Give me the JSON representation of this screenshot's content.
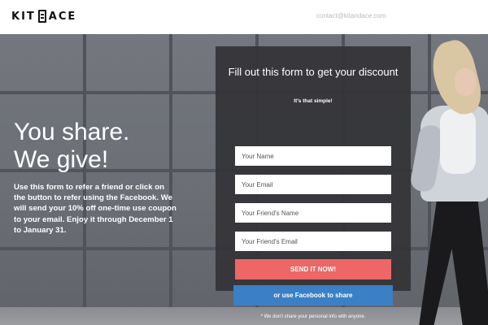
{
  "header": {
    "logo_text_left": "KIT",
    "logo_text_right": "ACE",
    "contact_email": "contact@kitandace.com"
  },
  "hero": {
    "headline_line1": "You share.",
    "headline_line2": "We give!",
    "description": "Use this form to refer a friend or click on the button to refer using the Facebook. We will send your 10% off one-time use coupon to your email. Enjoy it through December 1 to January 31."
  },
  "form": {
    "title": "Fill out this form to get your discount",
    "subtitle": "It's that simple!",
    "fields": {
      "your_name_placeholder": "Your Name",
      "your_email_placeholder": "Your Email",
      "friend_name_placeholder": "Your Friend's Name",
      "friend_email_placeholder": "Your Friend's Email"
    },
    "send_label": "SEND IT NOW!",
    "facebook_label": "or use Facebook to share",
    "privacy_note": "* We don't share your personal info with anyone."
  },
  "colors": {
    "send_button": "#ee6666",
    "facebook_button": "#3b7fc4",
    "form_panel": "#343438"
  }
}
